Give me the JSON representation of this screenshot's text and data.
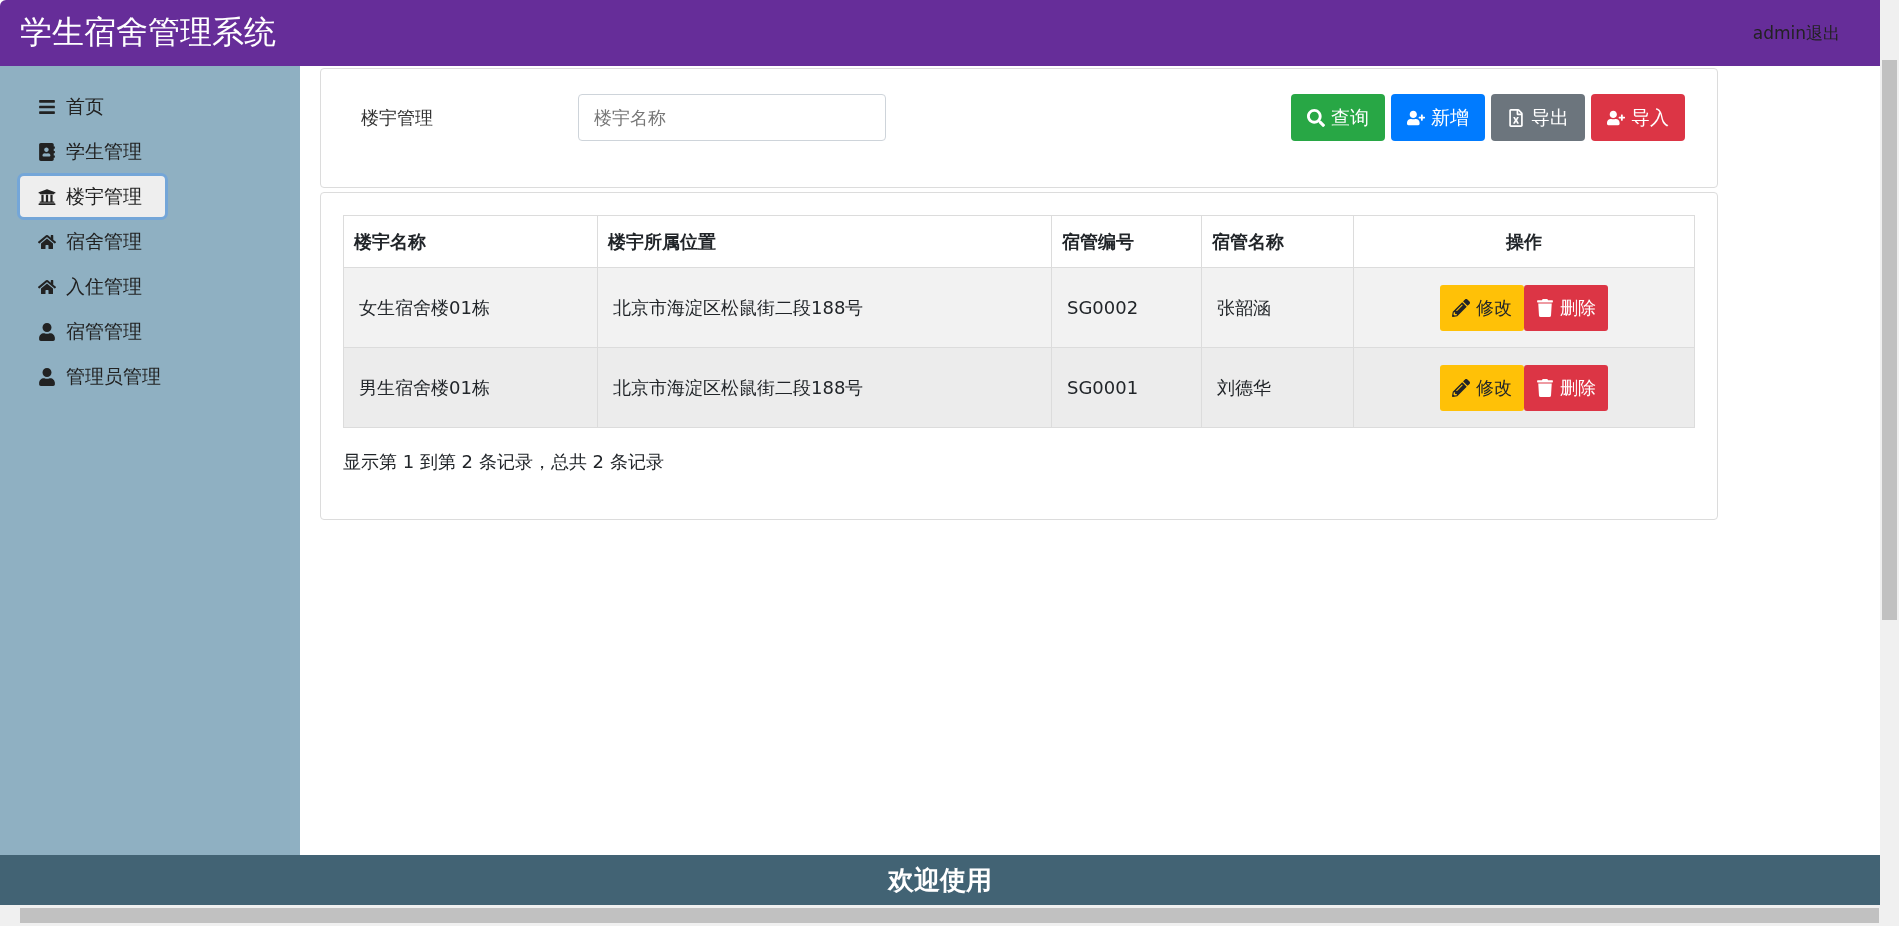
{
  "header": {
    "title": "学生宿舍管理系统",
    "user_link": "admin退出"
  },
  "sidebar": {
    "items": [
      {
        "label": "首页",
        "kind": "menu",
        "selected": false
      },
      {
        "label": "学生管理",
        "kind": "contacts",
        "selected": false
      },
      {
        "label": "楼宇管理",
        "kind": "building",
        "selected": true
      },
      {
        "label": "宿舍管理",
        "kind": "home",
        "selected": false
      },
      {
        "label": "入住管理",
        "kind": "home",
        "selected": false
      },
      {
        "label": "宿管管理",
        "kind": "user",
        "selected": false
      },
      {
        "label": "管理员管理",
        "kind": "user",
        "selected": false
      }
    ]
  },
  "search_panel": {
    "label": "楼宇管理",
    "search": {
      "placeholder": "楼宇名称"
    },
    "buttons": [
      {
        "label": "查询",
        "kind": "search"
      },
      {
        "label": "新增",
        "kind": "add"
      },
      {
        "label": "导出",
        "kind": "export"
      },
      {
        "label": "导入",
        "kind": "import"
      }
    ]
  },
  "table": {
    "columns": [
      "楼宇名称",
      "楼宇所属位置",
      "宿管编号",
      "宿管名称",
      "操作"
    ],
    "rows": [
      {
        "cells": [
          "女生宿舍楼01栋",
          "北京市海淀区松鼠街二段188号",
          "SG0002",
          "张韶涵"
        ],
        "actions": [
          {
            "label": "修改",
            "kind": "edit"
          },
          {
            "label": "删除",
            "kind": "delete"
          }
        ]
      },
      {
        "cells": [
          "男生宿舍楼01栋",
          "北京市海淀区松鼠街二段188号",
          "SG0001",
          "刘德华"
        ],
        "actions": [
          {
            "label": "修改",
            "kind": "edit"
          },
          {
            "label": "删除",
            "kind": "delete"
          }
        ]
      }
    ]
  },
  "pagination": {
    "summary": "显示第 1 到第 2 条记录，总共 2 条记录"
  },
  "footer": {
    "text": "欢迎使用"
  }
}
